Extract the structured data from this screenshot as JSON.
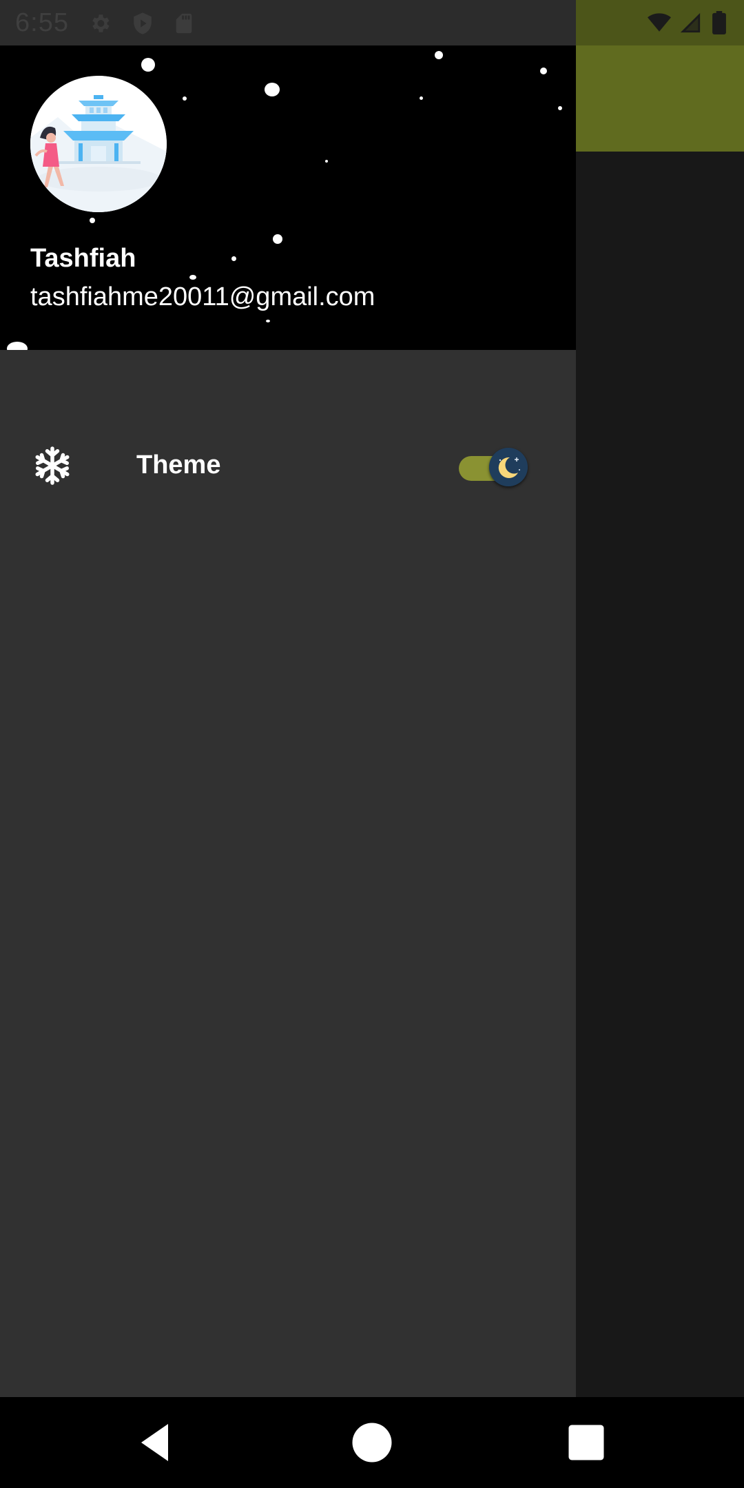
{
  "status_bar": {
    "time": "6:55",
    "left_icons": [
      "settings-icon",
      "play-protect-icon",
      "sd-card-icon"
    ],
    "right_icons": [
      "wifi-icon",
      "cell-signal-icon",
      "battery-icon"
    ]
  },
  "drawer": {
    "header": {
      "user_name": "Tashfiah",
      "user_email": "tashfiahme20011@gmail.com",
      "background": "#000000"
    },
    "items": [
      {
        "icon": "snowflake-icon",
        "label": "Theme",
        "toggle": {
          "state": "on",
          "mode": "dark",
          "track_color": "#8a9232",
          "thumb_icon": "moon-icon"
        }
      }
    ]
  },
  "app": {
    "appbar_color": "#606b1f"
  },
  "nav_bar": {
    "buttons": [
      "back-icon",
      "home-icon",
      "recents-icon"
    ]
  }
}
